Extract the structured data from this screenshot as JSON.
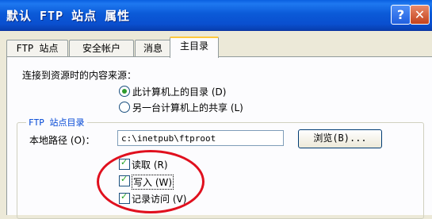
{
  "window": {
    "title": "默认 FTP 站点 属性",
    "help": "?",
    "close": "✕"
  },
  "tabs": [
    {
      "label": "FTP 站点"
    },
    {
      "label": "安全帐户"
    },
    {
      "label": "消息"
    },
    {
      "label": "主目录"
    }
  ],
  "source": {
    "label": "连接到资源时的内容来源：",
    "options": [
      {
        "label": "此计算机上的目录 (D)",
        "selected": true
      },
      {
        "label": "另一台计算机上的共享 (L)",
        "selected": false
      }
    ]
  },
  "site_dir": {
    "group_title": "FTP 站点目录",
    "path_label": "本地路径 (O)：",
    "path_value": "c:\\inetpub\\ftproot",
    "browse_label": "浏览(B)...",
    "checkboxes": [
      {
        "label": "读取 (R)",
        "checked": true
      },
      {
        "label": "写入 (W)",
        "checked": true
      },
      {
        "label": "记录访问 (V)",
        "checked": true
      }
    ]
  }
}
